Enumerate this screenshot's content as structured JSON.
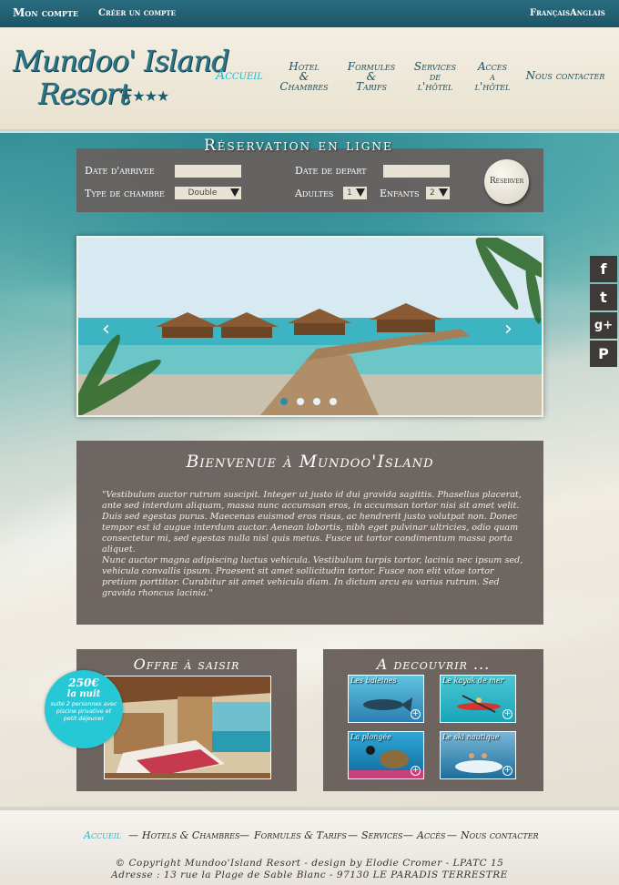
{
  "topbar": {
    "my_account": "Mon compte",
    "create_account": "Créer un compte",
    "lang_fr": "Français",
    "lang_en": "Anglais"
  },
  "logo": {
    "line1": "Mundoo' Island",
    "line2": "Resort",
    "stars": "★★★★"
  },
  "nav": {
    "home": "Accueil",
    "hotel_1": "Hotel",
    "hotel_2": "&",
    "hotel_3": "Chambres",
    "formulas_1": "Formules",
    "formulas_2": "&",
    "formulas_3": "Tarifs",
    "services_1": "Services",
    "services_2": "de",
    "services_3": "l'hôtel",
    "access_1": "Acces",
    "access_2": "a",
    "access_3": "l'hôtel",
    "contact": "Nous contacter"
  },
  "reservation": {
    "title": "Réservation en ligne",
    "arrival_label": "Date d'arrivee",
    "departure_label": "Date de depart",
    "room_type_label": "Type de chambre",
    "room_type_value": "Double",
    "adults_label": "Adultes",
    "adults_value": "1",
    "children_label": "Enfants",
    "children_value": "2",
    "button": "Réserver"
  },
  "slider": {
    "prev": "‹",
    "next": "›",
    "dots": 4,
    "active_dot": 0
  },
  "social": {
    "facebook": "f",
    "twitter": "t",
    "googleplus": "g+",
    "pinterest": "P"
  },
  "welcome": {
    "title": "Bienvenue à Mundoo'Island",
    "text_1": "\"Vestibulum auctor rutrum suscipit. Integer ut justo id dui gravida sagittis. Phasellus placerat, ante sed interdum aliquam, massa nunc accumsan eros, in accumsan tortor nisi sit amet velit. Duis sed egestas purus. Maecenas euismod eros risus, ac hendrerit justo volutpat non. Donec tempor est id augue interdum auctor. Aenean lobortis, nibh eget pulvinar ultricies, odio quam consectetur mi, sed egestas nulla nisl quis metus. Fusce ut tortor condimentum massa porta aliquet.",
    "text_2": "Nunc auctor magna adipiscing luctus vehicula. Vestibulum turpis tortor, lacinia nec ipsum sed, vehicula convallis ipsum. Praesent sit amet sollicitudin tortor. Fusce non elit vitae tortor pretium porttitor. Curabitur sit amet vehicula diam. In dictum arcu eu varius rutrum. Sed gravida rhoncus lacinia.\""
  },
  "offer": {
    "title": "Offre à saisir",
    "price": "250€",
    "per": "la nuit",
    "details": "suite 2 personnes avec piscine privative et petit déjeuner"
  },
  "discover": {
    "title": "A decouvrir ...",
    "tiles": [
      {
        "label": "Les baleines",
        "plus": "+"
      },
      {
        "label": "Le kayak de mer",
        "plus": "+"
      },
      {
        "label": "La plongée",
        "plus": "+"
      },
      {
        "label": "Le ski nautique",
        "plus": "+"
      }
    ]
  },
  "footer": {
    "nav": [
      "Accueil",
      "Hotels & Chambres",
      "Formules & Tarifs",
      "Services",
      "Accès",
      "Nous contacter"
    ],
    "sep": "—",
    "copyright": "© Copyright Mundoo'Island Resort - design by Elodie Cromer - LPATC 15",
    "address": "Adresse : 13 rue la Plage de Sable Blanc - 97130 LE PARADIS TERRESTRE"
  },
  "colors": {
    "accent": "#27b6c8",
    "panel": "#665d59",
    "topbar": "#1f5d6e"
  }
}
